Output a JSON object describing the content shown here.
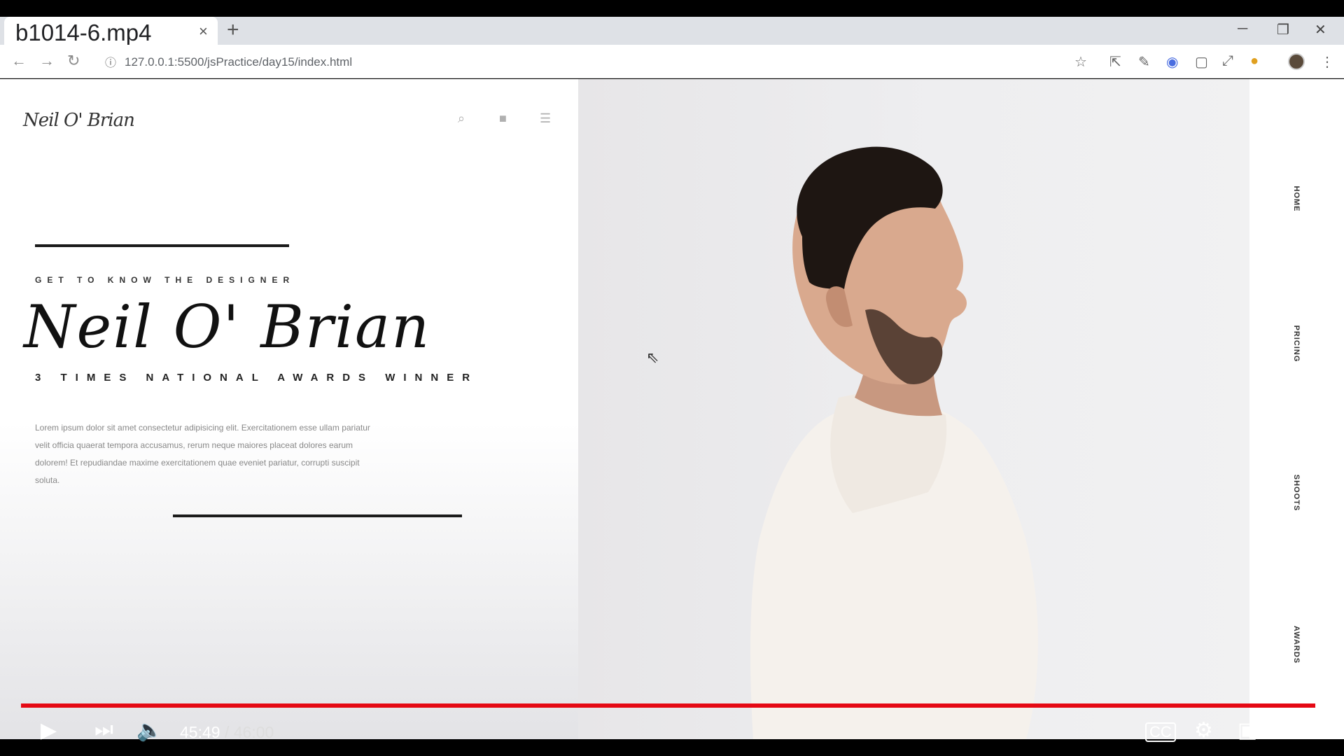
{
  "browser": {
    "tab_title": "b1014-6.mp4",
    "tab_close": "×",
    "new_tab": "+",
    "url": "127.0.0.1:5500/jsPractice/day15/index.html"
  },
  "page": {
    "logo": "Neil O' Brian",
    "eyebrow": "GET TO KNOW THE DESIGNER",
    "name": "Neil O' Brian",
    "tagline": "3 TIMES NATIONAL AWARDS WINNER",
    "body": "Lorem ipsum dolor sit amet consectetur adipisicing elit. Exercitationem esse ullam pariatur velit officia quaerat tempora accusamus, rerum neque maiores placeat dolores earum dolorem! Et repudiandae maxime exercitationem quae eveniet pariatur, corrupti suscipit soluta.",
    "nav": [
      "HOME",
      "PRICING",
      "SHOOTS",
      "AWARDS"
    ],
    "icons": [
      "search-icon",
      "bag-icon",
      "menu-icon"
    ]
  },
  "player": {
    "current_time": "45:49",
    "separator": "/",
    "duration": "46:00",
    "progress_fraction": 0.996,
    "progress_color": "#e50914"
  }
}
